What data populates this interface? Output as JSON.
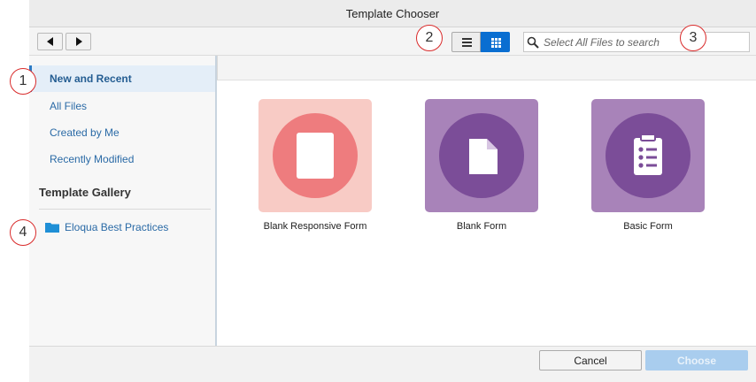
{
  "window": {
    "title": "Template Chooser"
  },
  "toolbar": {
    "back_icon": "triangle-left-icon",
    "forward_icon": "triangle-right-icon",
    "list_view_icon": "list-icon",
    "grid_view_icon": "grid-icon",
    "search_placeholder": "Select All Files to search",
    "search_value": ""
  },
  "sidebar": {
    "items": [
      {
        "label": "New and Recent",
        "active": true
      },
      {
        "label": "All Files"
      },
      {
        "label": "Created by Me"
      },
      {
        "label": "Recently Modified"
      }
    ],
    "gallery_title": "Template Gallery",
    "gallery_items": [
      {
        "label": "Eloqua Best Practices",
        "icon": "folder-icon"
      }
    ]
  },
  "templates": [
    {
      "label": "Blank Responsive Form",
      "icon": "blank-page-icon",
      "tile_color": "#f8cbc5",
      "circle_color": "#ee7c7e"
    },
    {
      "label": "Blank Form",
      "icon": "document-icon",
      "tile_color": "#a883b9",
      "circle_color": "#7b4d98"
    },
    {
      "label": "Basic Form",
      "icon": "clipboard-form-icon",
      "tile_color": "#a883b9",
      "circle_color": "#7b4d98"
    }
  ],
  "footer": {
    "cancel_label": "Cancel",
    "choose_label": "Choose"
  },
  "callouts": [
    "1",
    "2",
    "3",
    "4"
  ],
  "colors": {
    "accent": "#0a6ed1",
    "callout_ring": "#d92a2a",
    "link": "#2a6aa6"
  }
}
